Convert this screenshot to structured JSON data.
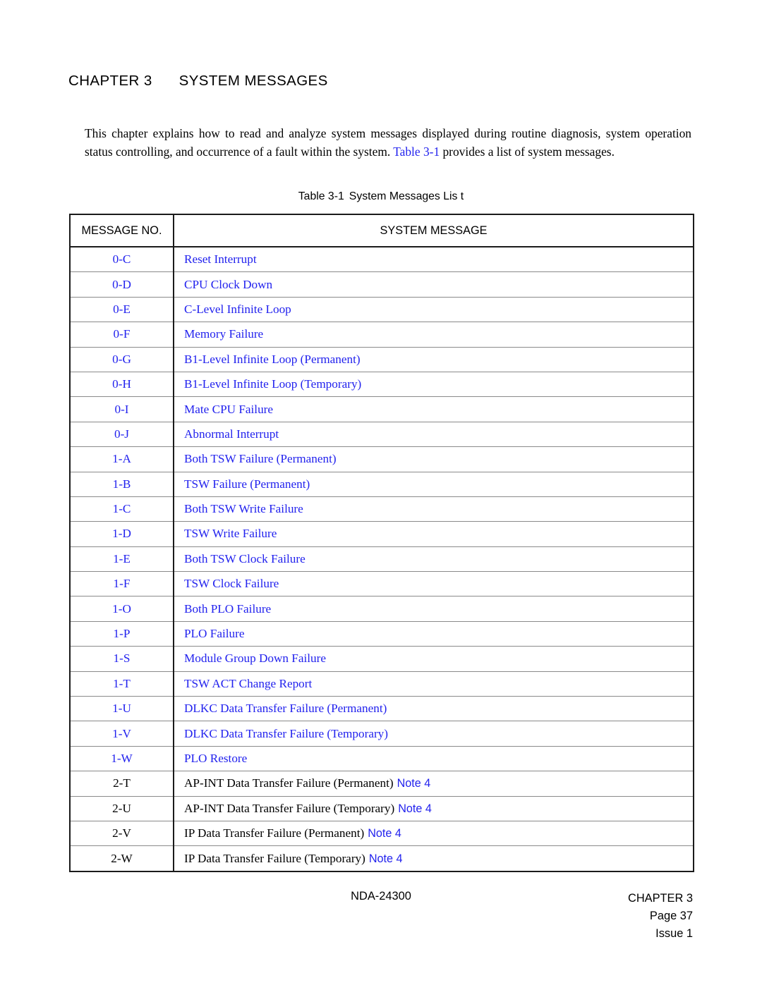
{
  "document": {
    "chapter_label": "CHAPTER 3",
    "chapter_title": "SYSTEM MESSAGES"
  },
  "intro": {
    "part1": "This chapter explains how to read and analyze system messages displayed during routine diagnosis, system operation status controlling, and occurrence of a fault within the system. ",
    "link": "Table 3-1",
    "part2": " provides a list of system messages."
  },
  "table_caption": {
    "number": "Table 3-1",
    "title": "System Messages Lis t"
  },
  "table": {
    "headers": {
      "message_no": "MESSAGE NO.",
      "system_message": "SYSTEM MESSAGE"
    },
    "rows": [
      {
        "no": "0-C",
        "message": "Reset Interrupt",
        "note": "",
        "style": "link"
      },
      {
        "no": "0-D",
        "message": "CPU Clock Down",
        "note": "",
        "style": "link"
      },
      {
        "no": "0-E",
        "message": "C-Level Infinite Loop",
        "note": "",
        "style": "link"
      },
      {
        "no": "0-F",
        "message": "Memory Failure",
        "note": "",
        "style": "link"
      },
      {
        "no": "0-G",
        "message": "B1-Level Infinite Loop (Permanent)",
        "note": "",
        "style": "link"
      },
      {
        "no": "0-H",
        "message": "B1-Level Infinite Loop (Temporary)",
        "note": "",
        "style": "link"
      },
      {
        "no": "0-I",
        "message": "Mate CPU Failure",
        "note": "",
        "style": "link"
      },
      {
        "no": "0-J",
        "message": "Abnormal Interrupt",
        "note": "",
        "style": "link"
      },
      {
        "no": "1-A",
        "message": "Both TSW Failure (Permanent)",
        "note": "",
        "style": "link"
      },
      {
        "no": "1-B",
        "message": "TSW Failure (Permanent)",
        "note": "",
        "style": "link"
      },
      {
        "no": "1-C",
        "message": "Both TSW Write Failure",
        "note": "",
        "style": "link"
      },
      {
        "no": "1-D",
        "message": "TSW Write Failure",
        "note": "",
        "style": "link"
      },
      {
        "no": "1-E",
        "message": "Both TSW Clock Failure",
        "note": "",
        "style": "link"
      },
      {
        "no": "1-F",
        "message": "TSW Clock Failure",
        "note": "",
        "style": "link"
      },
      {
        "no": "1-O",
        "message": "Both PLO Failure",
        "note": "",
        "style": "link"
      },
      {
        "no": "1-P",
        "message": "PLO Failure",
        "note": "",
        "style": "link"
      },
      {
        "no": "1-S",
        "message": "Module Group Down Failure",
        "note": "",
        "style": "link"
      },
      {
        "no": "1-T",
        "message": "TSW ACT Change Report",
        "note": "",
        "style": "link"
      },
      {
        "no": "1-U",
        "message": "DLKC Data Transfer Failure (Permanent)",
        "note": "",
        "style": "link"
      },
      {
        "no": "1-V",
        "message": "DLKC Data Transfer Failure (Temporary)",
        "note": "",
        "style": "link"
      },
      {
        "no": "1-W",
        "message": "PLO Restore",
        "note": "",
        "style": "link"
      },
      {
        "no": "2-T",
        "message": "AP-INT Data Transfer Failure (Permanent)",
        "note": "Note 4",
        "style": "plain"
      },
      {
        "no": "2-U",
        "message": "AP-INT Data Transfer Failure (Temporary)",
        "note": "Note 4",
        "style": "plain"
      },
      {
        "no": "2-V",
        "message": "IP Data Transfer Failure (Permanent)",
        "note": "Note 4",
        "style": "plain"
      },
      {
        "no": "2-W",
        "message": "IP Data Transfer Failure (Temporary)",
        "note": "Note 4",
        "style": "plain"
      }
    ]
  },
  "footer": {
    "doc_id": "NDA-24300",
    "chapter": "CHAPTER 3",
    "page": "Page 37",
    "issue": "Issue 1"
  },
  "colors": {
    "link_blue": "#2222EE",
    "text_black": "#000000",
    "rule_gray": "#8A8A8A",
    "border_black": "#1A1A1A"
  }
}
